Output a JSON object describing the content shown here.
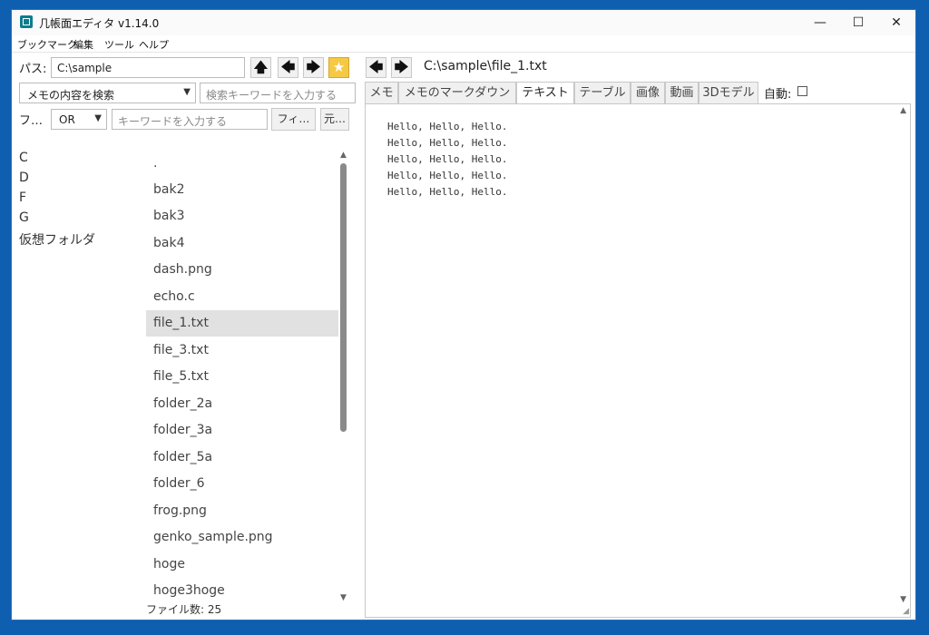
{
  "window": {
    "title": "几帳面エディタ v1.14.0",
    "minimize": "—",
    "maximize": "☐",
    "close": "✕"
  },
  "menu": [
    "ブックマーク",
    "編集",
    "ツール",
    "ヘルプ"
  ],
  "left": {
    "path_label": "パス:",
    "path_value": "C:\\sample",
    "up_icon": "🡅",
    "back_icon": "🡄",
    "forward_icon": "🡆",
    "star_icon": "★",
    "search_mode": "メモの内容を検索",
    "search_placeholder": "検索キーワードを入力する",
    "filter_label": "フ…",
    "filter_op": "OR",
    "keyword_placeholder": "キーワードを入力する",
    "filter_button": "フィ…",
    "restore_button": "元…",
    "drives": [
      "C",
      "D",
      "F",
      "G",
      "仮想フォルダ"
    ],
    "files": [
      ".",
      "bak2",
      "bak3",
      "bak4",
      "dash.png",
      "echo.c",
      "file_1.txt",
      "file_3.txt",
      "file_5.txt",
      "folder_2a",
      "folder_3a",
      "folder_5a",
      "folder_6",
      "frog.png",
      "genko_sample.png",
      "hoge",
      "hoge3hoge"
    ],
    "selected_file": "file_1.txt",
    "file_count": "ファイル数: 25"
  },
  "right": {
    "back_icon": "🡄",
    "forward_icon": "🡆",
    "path": "C:\\sample\\file_1.txt",
    "tabs": [
      "メモ",
      "メモのマークダウン",
      "テキスト",
      "テーブル",
      "画像",
      "動画",
      "3Dモデル"
    ],
    "active_tab": "テキスト",
    "auto_label": "自動:",
    "auto_checked": false,
    "text_lines": [
      "Hello, Hello, Hello.",
      "Hello, Hello, Hello.",
      "Hello, Hello, Hello.",
      "Hello, Hello, Hello.",
      "Hello, Hello, Hello."
    ]
  },
  "colors": {
    "desktop": "#0f5fb0",
    "star_button": "#f6c944",
    "selected_row": "#e1e1e1"
  }
}
